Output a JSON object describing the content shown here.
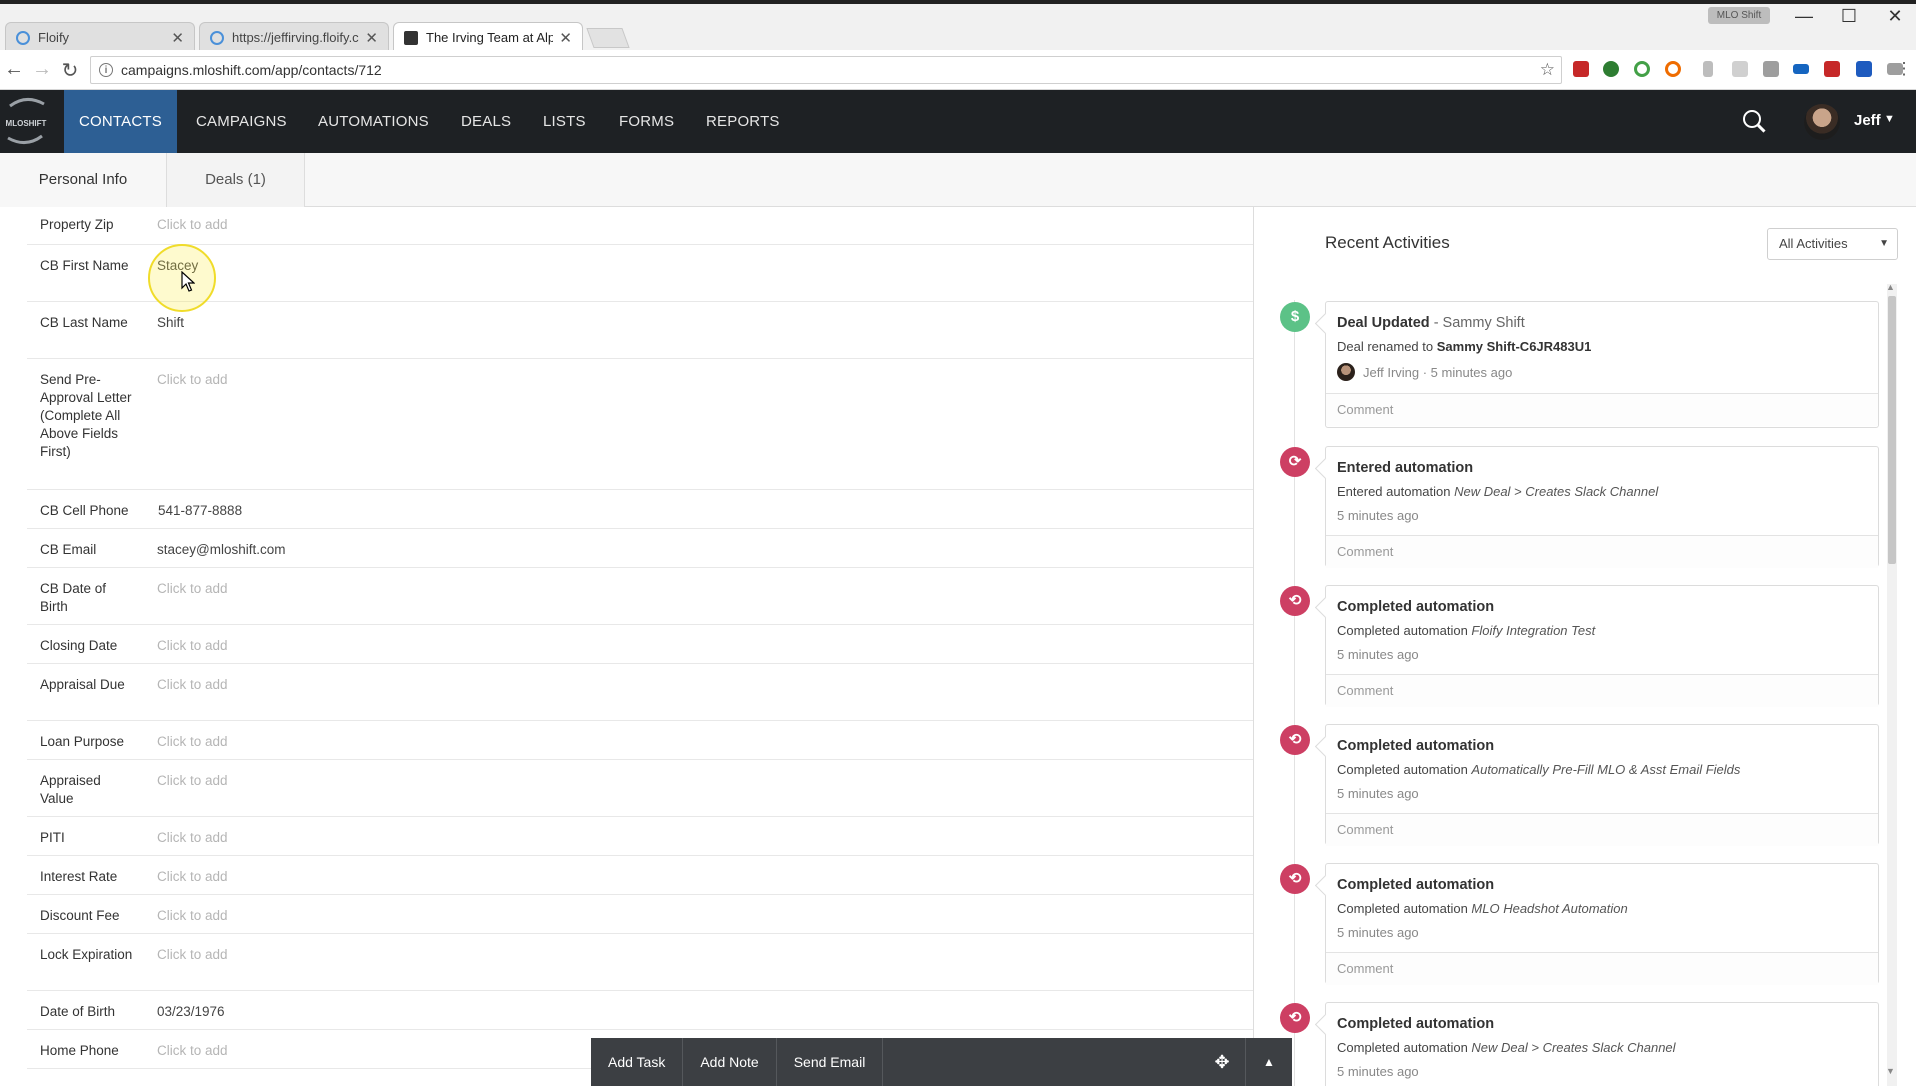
{
  "browser": {
    "tabs": [
      {
        "label": "Floify",
        "active": false
      },
      {
        "label": "https://jeffirving.floify.co",
        "active": false
      },
      {
        "label": "The Irving Team at Alpin",
        "active": true
      }
    ],
    "profile_chip": "MLO Shift",
    "url": "campaigns.mloshift.com/app/contacts/712",
    "window_controls": {
      "minimize": "—",
      "maximize": "☐",
      "close": "✕"
    },
    "nav_icons": {
      "back": "←",
      "forward": "→",
      "reload": "↻",
      "star": "☆",
      "menu": "⋮"
    }
  },
  "app": {
    "logo_text": "MLOSHIFT",
    "nav": [
      {
        "label": "CONTACTS",
        "active": true
      },
      {
        "label": "CAMPAIGNS",
        "active": false
      },
      {
        "label": "AUTOMATIONS",
        "active": false
      },
      {
        "label": "DEALS",
        "active": false
      },
      {
        "label": "LISTS",
        "active": false
      },
      {
        "label": "FORMS",
        "active": false
      },
      {
        "label": "REPORTS",
        "active": false
      }
    ],
    "user": {
      "name": "Jeff",
      "caret": "▼"
    }
  },
  "page_tabs": [
    {
      "label": "Personal Info",
      "active": true
    },
    {
      "label": "Deals (1)",
      "active": false
    }
  ],
  "fields": [
    {
      "label": "Property Zip",
      "value": "Click to add",
      "empty": true
    },
    {
      "label": "CB First Name",
      "value": "Stacey",
      "empty": false
    },
    {
      "label": "CB Last Name",
      "value": "Shift",
      "empty": false
    },
    {
      "label": "Send Pre-Approval Letter (Complete All Above Fields First)",
      "value": "Click to add",
      "empty": true
    },
    {
      "label": "CB Cell Phone",
      "value": "541-877-8888",
      "empty": false
    },
    {
      "label": "CB Email",
      "value": "stacey@mloshift.com",
      "empty": false
    },
    {
      "label": "CB Date of Birth",
      "value": "Click to add",
      "empty": true
    },
    {
      "label": "Closing Date",
      "value": "Click to add",
      "empty": true
    },
    {
      "label": "Appraisal Due",
      "value": "Click to add",
      "empty": true
    },
    {
      "label": "Loan Purpose",
      "value": "Click to add",
      "empty": true
    },
    {
      "label": "Appraised Value",
      "value": "Click to add",
      "empty": true
    },
    {
      "label": "PITI",
      "value": "Click to add",
      "empty": true
    },
    {
      "label": "Interest Rate",
      "value": "Click to add",
      "empty": true
    },
    {
      "label": "Discount Fee",
      "value": "Click to add",
      "empty": true
    },
    {
      "label": "Lock Expiration",
      "value": "Click to add",
      "empty": true
    },
    {
      "label": "Date of Birth",
      "value": "03/23/1976",
      "empty": false
    },
    {
      "label": "Home Phone",
      "value": "Click to add",
      "empty": true
    }
  ],
  "activities": {
    "title": "Recent Activities",
    "filter": "All Activities",
    "comment_label": "Comment",
    "items": [
      {
        "icon": "dollar-icon",
        "badge": "$",
        "color": "#5cc287",
        "title": "Deal Updated",
        "subtitle": " - Sammy Shift",
        "desc_prefix": "Deal renamed to ",
        "desc_value": "Sammy Shift-C6JR483U1",
        "desc_style": "bold",
        "meta": "Jeff Irving · 5 minutes ago",
        "has_avatar": true
      },
      {
        "icon": "refresh-icon",
        "badge": "⟳",
        "color": "#cd3f63",
        "title": "Entered automation",
        "subtitle": "",
        "desc_prefix": "Entered automation ",
        "desc_value": "New Deal > Creates Slack Channel",
        "desc_style": "italic",
        "meta": "5 minutes ago",
        "has_avatar": false
      },
      {
        "icon": "automation-complete-icon",
        "badge": "⟲",
        "color": "#cd3f63",
        "title": "Completed automation",
        "subtitle": "",
        "desc_prefix": "Completed automation ",
        "desc_value": "Floify Integration Test",
        "desc_style": "italic",
        "meta": "5 minutes ago",
        "has_avatar": false
      },
      {
        "icon": "automation-complete-icon",
        "badge": "⟲",
        "color": "#cd3f63",
        "title": "Completed automation",
        "subtitle": "",
        "desc_prefix": "Completed automation ",
        "desc_value": "Automatically Pre-Fill MLO & Asst Email Fields",
        "desc_style": "italic",
        "meta": "5 minutes ago",
        "has_avatar": false
      },
      {
        "icon": "automation-complete-icon",
        "badge": "⟲",
        "color": "#cd3f63",
        "title": "Completed automation",
        "subtitle": "",
        "desc_prefix": "Completed automation ",
        "desc_value": "MLO Headshot Automation",
        "desc_style": "italic",
        "meta": "5 minutes ago",
        "has_avatar": false
      },
      {
        "icon": "automation-complete-icon",
        "badge": "⟲",
        "color": "#cd3f63",
        "title": "Completed automation",
        "subtitle": "",
        "desc_prefix": "Completed automation ",
        "desc_value": "New Deal > Creates Slack Channel",
        "desc_style": "italic",
        "meta": "5 minutes ago",
        "has_avatar": false
      }
    ]
  },
  "action_bar": {
    "buttons": [
      "Add Task",
      "Add Note",
      "Send Email"
    ],
    "move_icon": "✥",
    "collapse_icon": "▲"
  },
  "colors": {
    "nav_bg": "#1e2124",
    "nav_active": "#2d5f94",
    "badge_green": "#5cc287",
    "badge_red": "#cd3f63",
    "action_bar": "#3c3f43"
  }
}
